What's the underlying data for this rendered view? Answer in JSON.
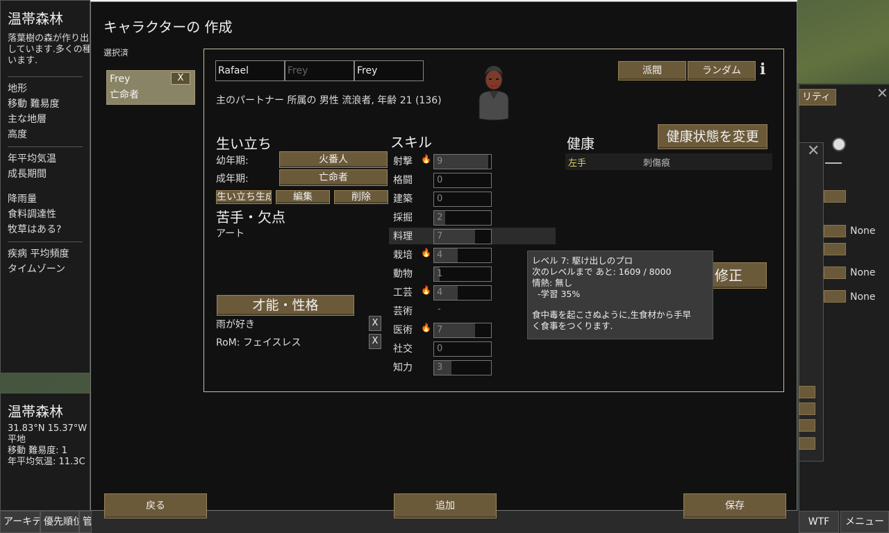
{
  "left_panel": {
    "title": "温帯森林",
    "desc_lines": [
      "落葉樹の森が作り出",
      "しています.多くの種",
      "います."
    ],
    "rows_a": [
      "地形",
      "移動 難易度",
      "主な地層",
      "高度"
    ],
    "rows_b": [
      "年平均気温",
      "成長期間"
    ],
    "rows_c": [
      "降雨量",
      "食料調達性",
      "牧草はある?"
    ],
    "rows_d": [
      "疾病 平均頻度",
      "タイムゾーン"
    ]
  },
  "left_bottom": {
    "title": "温帯森林",
    "coords": "31.83°N 15.37°W",
    "terrain": "平地",
    "movement": "移動 難易度: 1",
    "temp": "年平均気温: 11.3C"
  },
  "bottom_bar": {
    "architect": "アーキテク",
    "priority": "優先順位",
    "manage": "管",
    "wtf": "WTF",
    "menu": "メニュー"
  },
  "right_side": {
    "tab_label": "リティ",
    "none_1": "None",
    "none_2": "None",
    "none_3": "None"
  },
  "dialog": {
    "title": "キャラクターの 作成",
    "selected_label": "選択済",
    "pawn_card": {
      "name": "Frey",
      "role": "亡命者",
      "remove": "X"
    },
    "name": {
      "first": "Rafael",
      "nick_placeholder": "Frey",
      "last": "Frey"
    },
    "buttons": {
      "faction": "派閥",
      "random": "ランダム",
      "change_health": "健康状態を変更",
      "bio_generate": "生い立ち生成",
      "bio_edit": "編集",
      "bio_delete": "削除",
      "fix": "修正",
      "traits_header": "才能・性格",
      "back": "戻る",
      "add": "追加",
      "save": "保存"
    },
    "info_icon": "i",
    "description": "主のパートナー 所属の 男性 流浪者, 年齢 21 (136)",
    "backstory": {
      "title": "生い立ち",
      "childhood_label": "幼年期:",
      "childhood_value": "火番人",
      "adulthood_label": "成年期:",
      "adulthood_value": "亡命者"
    },
    "incapable": {
      "title": "苦手・欠点",
      "items": [
        "アート"
      ]
    },
    "traits": {
      "items": [
        {
          "name": "雨が好き",
          "remove": "X"
        },
        {
          "name": "RoM: フェイスレス",
          "remove": "X"
        }
      ]
    },
    "skills": {
      "title": "スキル",
      "list": [
        {
          "name": "射撃",
          "level": "9",
          "passion": true,
          "fill": 0.95
        },
        {
          "name": "格闘",
          "level": "0",
          "passion": false,
          "fill": 0.0
        },
        {
          "name": "建築",
          "level": "0",
          "passion": false,
          "fill": 0.0
        },
        {
          "name": "採掘",
          "level": "2",
          "passion": false,
          "fill": 0.2
        },
        {
          "name": "料理",
          "level": "7",
          "passion": false,
          "fill": 0.72
        },
        {
          "name": "栽培",
          "level": "4",
          "passion": true,
          "fill": 0.42
        },
        {
          "name": "動物",
          "level": "1",
          "passion": false,
          "fill": 0.1
        },
        {
          "name": "工芸",
          "level": "4",
          "passion": true,
          "fill": 0.42
        },
        {
          "name": "芸術",
          "level": "-",
          "passion": false,
          "disabled": true
        },
        {
          "name": "医術",
          "level": "7",
          "passion": true,
          "fill": 0.72
        },
        {
          "name": "社交",
          "level": "0",
          "passion": false,
          "fill": 0.0
        },
        {
          "name": "知力",
          "level": "3",
          "passion": false,
          "fill": 0.3
        }
      ]
    },
    "health": {
      "title": "健康",
      "part": "左手",
      "condition": "刺傷痕"
    },
    "tooltip": {
      "line1": "レベル 7: 駆け出しのプロ",
      "line2": "次のレベルまで あと: 1609 / 8000",
      "line3": "情熱: 無し",
      "line4": "  -学習 35%",
      "line5": "食中毒を起こさぬように,生食材から手早",
      "line6": "く食事をつくります."
    }
  }
}
